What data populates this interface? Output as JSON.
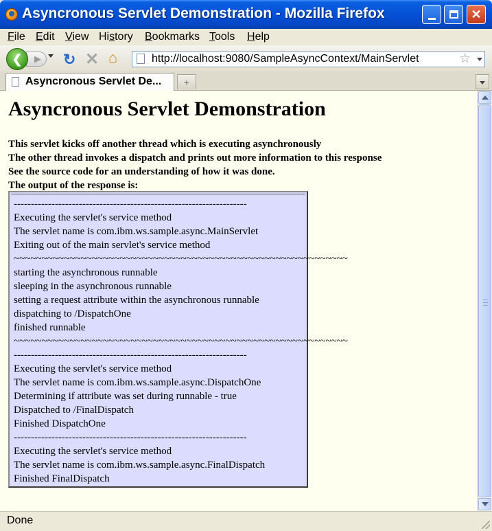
{
  "window": {
    "title": "Asyncronous Servlet Demonstration - Mozilla Firefox"
  },
  "menu": [
    {
      "key": "F",
      "rest": "ile"
    },
    {
      "key": "E",
      "rest": "dit"
    },
    {
      "key": "V",
      "rest": "iew"
    },
    {
      "pre": "Hi",
      "key": "s",
      "rest": "tory"
    },
    {
      "key": "B",
      "rest": "ookmarks"
    },
    {
      "key": "T",
      "rest": "ools"
    },
    {
      "key": "H",
      "rest": "elp"
    }
  ],
  "nav": {
    "url": "http://localhost:9080/SampleAsyncContext/MainServlet"
  },
  "tab": {
    "title": "Asyncronous Servlet De..."
  },
  "page": {
    "heading": "Asyncronous Servlet Demonstration",
    "intro": [
      "This servlet kicks off another thread which is executing asynchronously",
      "The other thread invokes a dispatch and prints out more information to this response",
      "See the source code for an understanding of how it was done.",
      "The output of the response is:"
    ],
    "output": [
      "--------------------------------------------------------------------",
      "Executing the servlet's service method",
      "The servlet name is com.ibm.ws.sample.async.MainServlet",
      "Exiting out of the main servlet's service method",
      "~~~~~~~~~~~~~~~~~~~~~~~~~~~~~~~~~~~~~~~~~~~~~~~~~~~~~~~~~~~~",
      "starting the asynchronous runnable",
      "sleeping in the asynchronous runnable",
      "setting a request attribute within the asynchronous runnable",
      "dispatching to /DispatchOne",
      "finished runnable",
      "~~~~~~~~~~~~~~~~~~~~~~~~~~~~~~~~~~~~~~~~~~~~~~~~~~~~~~~~~~~~",
      "--------------------------------------------------------------------",
      "Executing the servlet's service method",
      "The servlet name is com.ibm.ws.sample.async.DispatchOne",
      "Determining if attribute was set during runnable - true",
      "Dispatched to /FinalDispatch",
      "Finished DispatchOne",
      "--------------------------------------------------------------------",
      "Executing the servlet's service method",
      "The servlet name is com.ibm.ws.sample.async.FinalDispatch",
      "Finished FinalDispatch"
    ]
  },
  "status": {
    "text": "Done"
  }
}
